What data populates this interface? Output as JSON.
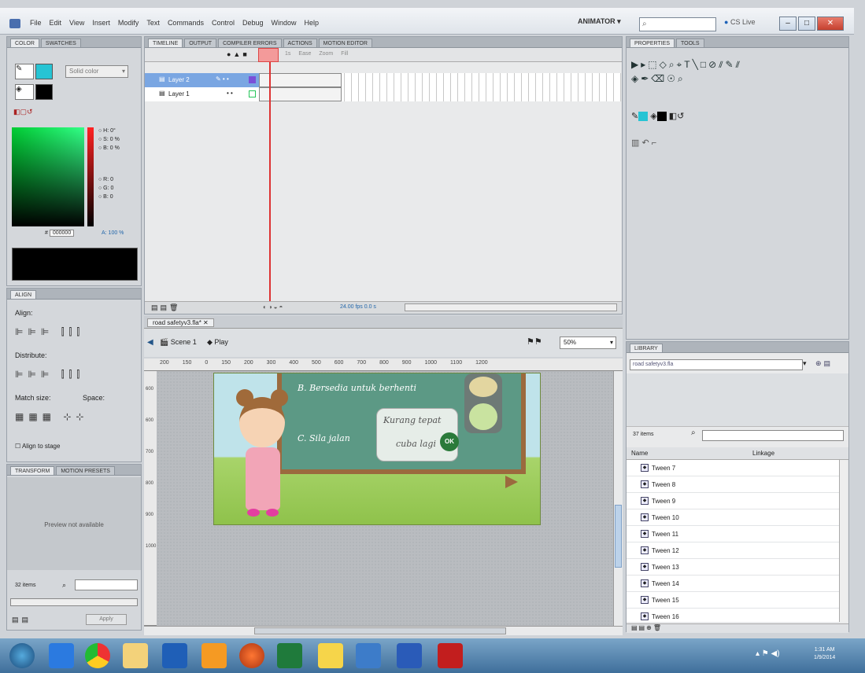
{
  "menubar": {
    "items": [
      "File",
      "Edit",
      "View",
      "Insert",
      "Modify",
      "Text",
      "Commands",
      "Control",
      "Debug",
      "Window",
      "Help"
    ],
    "workspace": "ANIMATOR ▾",
    "cs_live": "CS Live"
  },
  "left": {
    "color_tabs": [
      "COLOR",
      "SWATCHES"
    ],
    "fill_type": "Solid color",
    "hsb": [
      "H: 0°",
      "S: 0 %",
      "B: 0 %"
    ],
    "rgb": [
      "R: 0",
      "G: 0",
      "B: 0"
    ],
    "hex_label": "#",
    "hex": "000000",
    "alpha": "A: 100 %",
    "align_tab": "ALIGN",
    "align_label": "Align:",
    "distribute_label": "Distribute:",
    "match_label": "Match size:",
    "space_label": "Space:",
    "align_to_stage": "Align to stage",
    "transform_tabs": [
      "TRANSFORM",
      "MOTION PRESETS"
    ],
    "preview": "Preview not available",
    "items_count": "32 items",
    "apply": "Apply"
  },
  "timeline": {
    "tabs": [
      "TIMELINE",
      "OUTPUT",
      "COMPILER ERRORS",
      "ACTIONS",
      "MOTION EDITOR"
    ],
    "header_icons": [
      "eye-icon",
      "lock-icon",
      "outline-icon"
    ],
    "frame_labels": [
      "1s",
      "Ease",
      "Zoom",
      "Fill"
    ],
    "layers": [
      {
        "name": "Layer 2",
        "selected": true,
        "color": "#7a4fd8"
      },
      {
        "name": "Layer 1",
        "selected": false,
        "color": "#27c55a"
      }
    ],
    "status": "24.00 fps   0.0 s   "
  },
  "doc": {
    "tab": "road safetyv3.fla*",
    "scene": "Scene 1",
    "symbol": "Play",
    "zoom": "50%",
    "ruler_ticks": [
      "200",
      "150",
      "0",
      "150",
      "200",
      "300",
      "400",
      "500",
      "600",
      "700",
      "800",
      "900",
      "1000",
      "1100",
      "1200"
    ],
    "vruler_ticks": [
      "600",
      "600",
      "700",
      "800",
      "900",
      "1000"
    ],
    "stage": {
      "line1": "B. Bersedia untuk berhenti",
      "line2": "C. Sila jalan",
      "bubble1": "Kurang tepat",
      "bubble2": "cuba lagi",
      "button": "OK"
    }
  },
  "right": {
    "tabs": [
      "PROPERTIES",
      "TOOLS"
    ],
    "library_tab": "LIBRARY",
    "library_file": "road safetyv3.fla",
    "item_count": "37 items",
    "col_name": "Name",
    "col_linkage": "Linkage",
    "items": [
      "Tween 7",
      "Tween 8",
      "Tween 9",
      "Tween 10",
      "Tween 11",
      "Tween 12",
      "Tween 13",
      "Tween 14",
      "Tween 15",
      "Tween 16"
    ]
  },
  "taskbar": {
    "time": "1:31 AM",
    "date": "1/9/2014"
  }
}
